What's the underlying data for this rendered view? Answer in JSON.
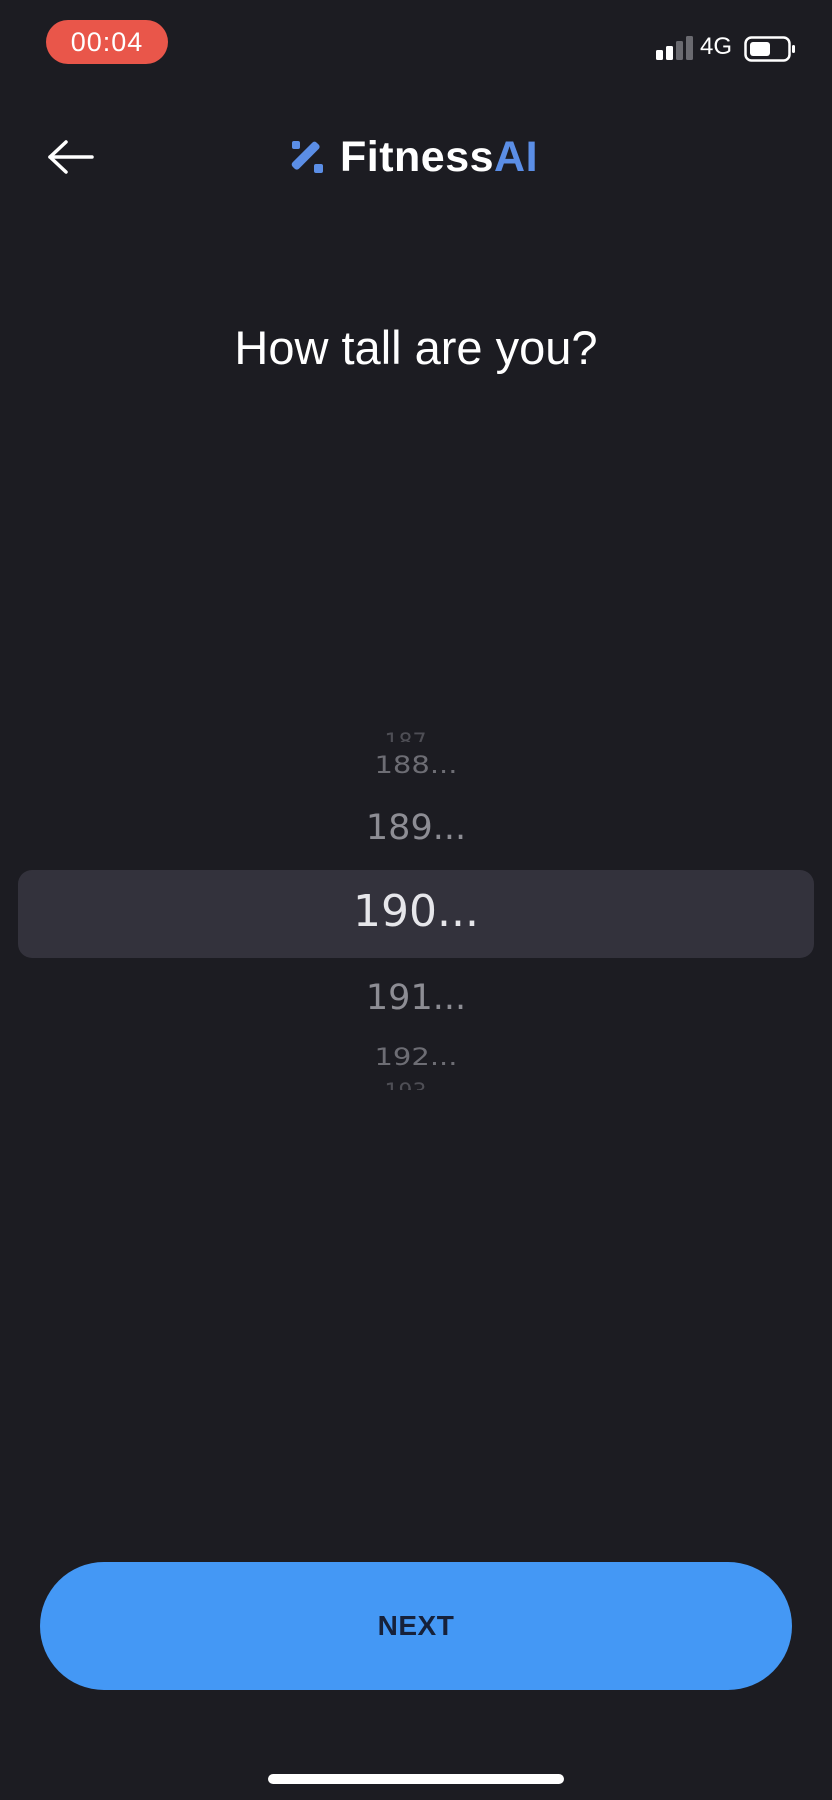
{
  "status_bar": {
    "time": "00:04",
    "network": "4G",
    "recording_color": "#e9564a"
  },
  "header": {
    "back_icon": "arrow-left-icon",
    "logo_icon": "fitnessai-logo-icon",
    "brand_main": "Fitness",
    "brand_accent": "AI",
    "accent_color": "#5b8ee6"
  },
  "question": {
    "title": "How tall are you?"
  },
  "height_picker": {
    "items_above": [
      "188...",
      "189..."
    ],
    "selected": "190...",
    "items_below": [
      "191...",
      "192..."
    ]
  },
  "footer": {
    "next_label": "NEXT",
    "button_color": "#4498f5"
  }
}
